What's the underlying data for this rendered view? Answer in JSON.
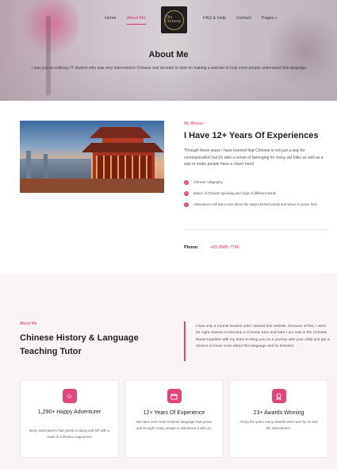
{
  "nav": {
    "items": [
      {
        "label": "Home"
      },
      {
        "label": "About Me"
      },
      {
        "label": "FAQ & Help"
      },
      {
        "label": "Contact"
      },
      {
        "label": "Pages"
      }
    ],
    "logo_text": "The Chinese"
  },
  "hero": {
    "title": "About Me",
    "text": "I was just an ordinary IT student who was very interested in Chinese and decided to start on making a website to help more people understand this language"
  },
  "mission": {
    "tag": "My Mission",
    "title": "I Have 12+ Years Of Experiences",
    "text": "Through these years I have learned that Chinese is not just a way for communication but it's also a sense of belonging for many old folks as well as a way to make people have a closer bond",
    "checklist": [
      "Chinese calligraphy",
      "Basics of Chinese speaking and origin of different words",
      "Adventurers will learn more about the stories behind words and where it comes from"
    ],
    "phone_label": "Phone:",
    "phone_value": "+65 8585 7746"
  },
  "about": {
    "tag": "About Me",
    "title": "Chinese History & Language Teaching Tutor",
    "text": "I was only a normal student until I started this website, because of this, I went for night classes to become a Chinese tutor and here I am now in the Chinese Room together with my team to bring you on a journey with your child and get a chance to know more about this language and its histories."
  },
  "cards": [
    {
      "icon": "smile-icon",
      "title": "1,290+ Happy Adventurer",
      "text": "Many adventurers had joined in along and left with a smile in a lifetime experience"
    },
    {
      "icon": "calendar-icon",
      "title": "12+ Years Of Experience",
      "text": "We have seen how Chinese language had grown and brought many people to witnessed it with us."
    },
    {
      "icon": "award-icon",
      "title": "23+ Awards Winning",
      "text": "Along the years many awards were won by us and the adventurers."
    }
  ],
  "colors": {
    "accent": "#e0457b",
    "accent_text": "#d6336c",
    "section_bg": "#fbf4f7"
  }
}
